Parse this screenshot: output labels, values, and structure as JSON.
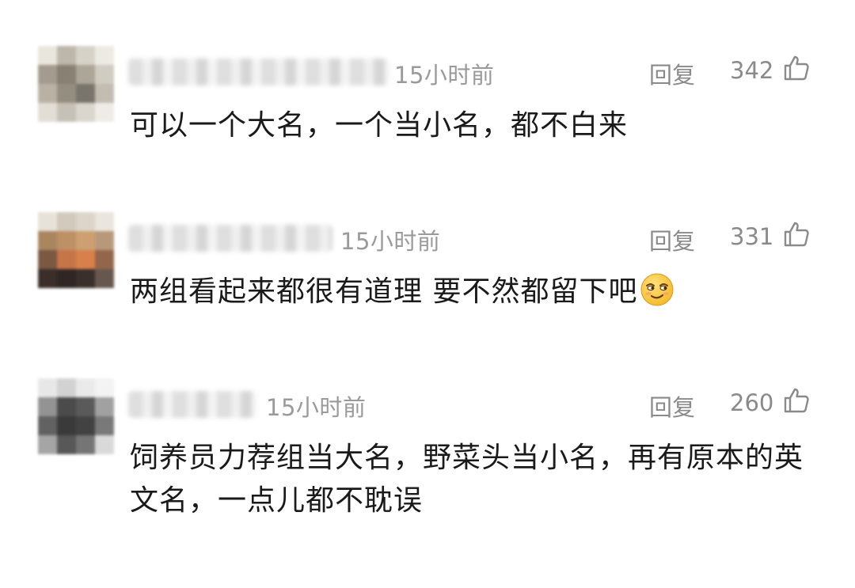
{
  "comments": [
    {
      "time": "15小时前",
      "reply_label": "回复",
      "likes": "342",
      "text": "可以一个大名，一个当小名，都不白来"
    },
    {
      "time": "15小时前",
      "reply_label": "回复",
      "likes": "331",
      "text": "两组看起来都很有道理 要不然都留下吧",
      "emoji": "smirk-emoji"
    },
    {
      "time": "15小时前",
      "reply_label": "回复",
      "likes": "260",
      "text": "饲养员力荐组当大名，野菜头当小名，再有原本的英文名，一点儿都不耽误"
    }
  ],
  "colors": {
    "meta_text": "#9a9a9a",
    "body_text": "#1a1a1a",
    "emoji_yellow": "#f7c531"
  }
}
